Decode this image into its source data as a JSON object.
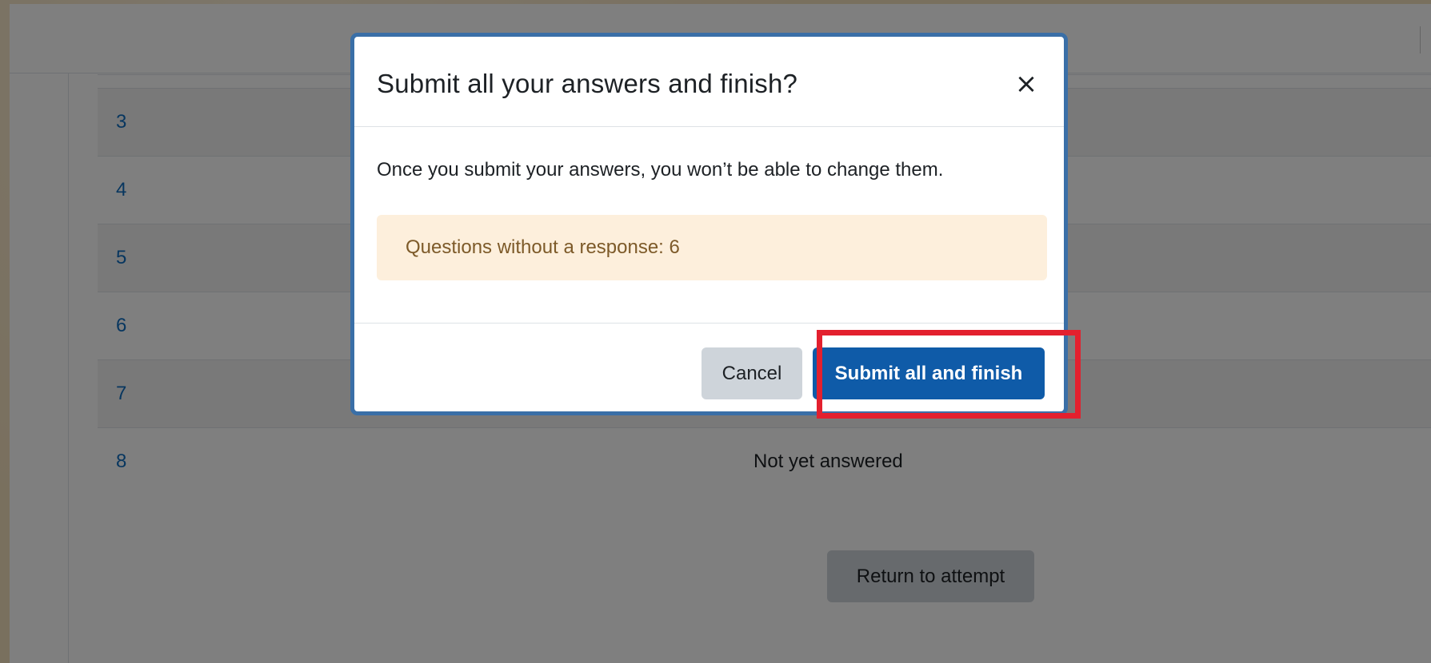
{
  "summary": {
    "rows": [
      {
        "num": "",
        "status": ""
      },
      {
        "num": "3",
        "status": ""
      },
      {
        "num": "4",
        "status": ""
      },
      {
        "num": "5",
        "status": ""
      },
      {
        "num": "6",
        "status": ""
      },
      {
        "num": "7",
        "status": ""
      },
      {
        "num": "8",
        "status": "Not yet answered"
      }
    ],
    "return_label": "Return to attempt"
  },
  "modal": {
    "title": "Submit all your answers and finish?",
    "close_symbol": "×",
    "message": "Once you submit your answers, you won’t be able to change them.",
    "warning": "Questions without a response: 6",
    "cancel_label": "Cancel",
    "submit_label": "Submit all and finish"
  },
  "colors": {
    "highlight": "#e3202e",
    "primary": "#0f5ba8",
    "link": "#0f6cbf",
    "warning_bg": "#fdefdc"
  }
}
